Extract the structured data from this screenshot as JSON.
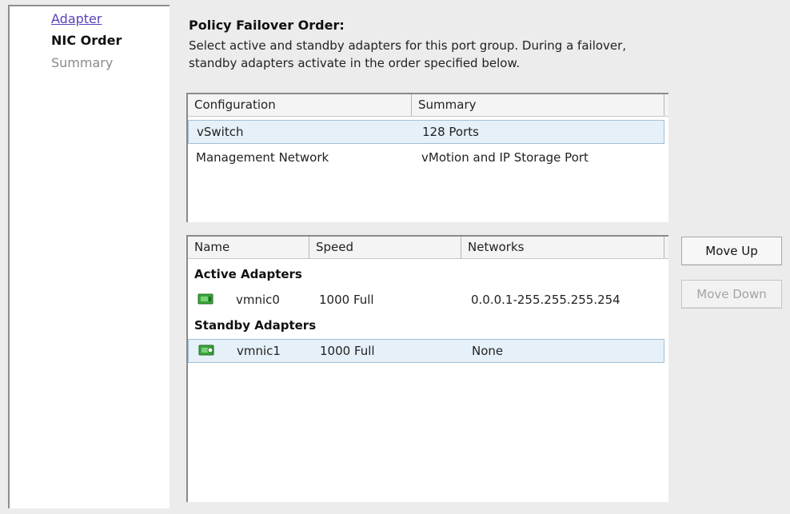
{
  "nav": {
    "items": [
      {
        "label": "Adapter",
        "state": "link"
      },
      {
        "label": "NIC Order",
        "state": "current"
      },
      {
        "label": "Summary",
        "state": "muted"
      }
    ]
  },
  "content": {
    "title": "Policy Failover Order:",
    "description": "Select active and standby adapters for this port group. During a failover, standby adapters activate in the order specified below."
  },
  "config_table": {
    "columns": [
      "Configuration",
      "Summary"
    ],
    "rows": [
      {
        "configuration": "vSwitch",
        "summary": "128 Ports",
        "selected": true
      },
      {
        "configuration": "Management Network",
        "summary": "vMotion and IP Storage Port",
        "selected": false
      }
    ]
  },
  "adapter_table": {
    "columns": [
      "Name",
      "Speed",
      "Networks"
    ],
    "active_label": "Active Adapters",
    "standby_label": "Standby Adapters",
    "active": [
      {
        "icon": "network-adapter-icon",
        "name": "vmnic0",
        "speed": "1000 Full",
        "networks": "0.0.0.1-255.255.255.254",
        "selected": false
      }
    ],
    "standby": [
      {
        "icon": "network-adapter-icon",
        "name": "vmnic1",
        "speed": "1000 Full",
        "networks": "None",
        "selected": true
      }
    ]
  },
  "buttons": {
    "move_up": "Move Up",
    "move_down": "Move Down"
  },
  "colors": {
    "selection_bg": "#e6f0f8",
    "link": "#5a3fb8",
    "nic_green": "#3aa53a"
  }
}
